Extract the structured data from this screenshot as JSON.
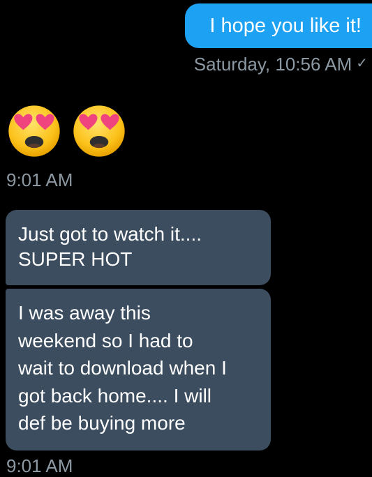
{
  "sent_message": {
    "text": "I hope you like it!",
    "timestamp": "Saturday, 10:56 AM",
    "status_icon": "checkmark-icon",
    "status_glyph": "✓",
    "bubble_color": "#1da1f2"
  },
  "emoji_message": {
    "emojis": [
      "heart-eyes-emoji-icon",
      "heart-eyes-emoji-icon"
    ],
    "timestamp": "9:01 AM"
  },
  "received_messages": {
    "bubble_color": "#3b4d5f",
    "items": [
      {
        "text": "Just got to watch it....\nSUPER HOT"
      },
      {
        "text": "I was away this\nweekend so I had to\nwait to download when I\ngot back home.... I will\ndef be buying more"
      }
    ],
    "timestamp": "9:01 AM"
  }
}
